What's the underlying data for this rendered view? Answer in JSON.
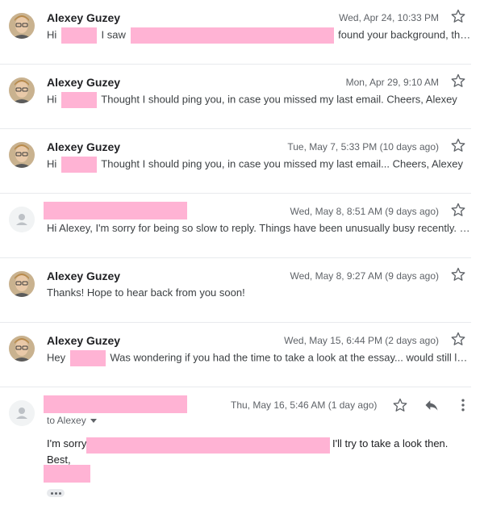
{
  "messages": [
    {
      "sender": "Alexey Guzey",
      "date": "Wed, Apr 24, 10:33 PM",
      "snippet_pre": "Hi",
      "snippet_mid": "I saw",
      "snippet_post": "found your background, tho..."
    },
    {
      "sender": "Alexey Guzey",
      "date": "Mon, Apr 29, 9:10 AM",
      "snippet_pre": "Hi",
      "snippet_post": "Thought I should ping you, in case you missed my last email. Cheers, Alexey"
    },
    {
      "sender": "Alexey Guzey",
      "date": "Tue, May 7, 5:33 PM (10 days ago)",
      "snippet_pre": "Hi",
      "snippet_post": "Thought I should ping you, in case you missed my last email... Cheers, Alexey"
    },
    {
      "date": "Wed, May 8, 8:51 AM (9 days ago)",
      "snippet": "Hi Alexey, I'm sorry for being so slow to reply. Things have been unusually busy recently. I..."
    },
    {
      "sender": "Alexey Guzey",
      "date": "Wed, May 8, 9:27 AM (9 days ago)",
      "snippet": "Thanks! Hope to hear back from you soon!"
    },
    {
      "sender": "Alexey Guzey",
      "date": "Wed, May 15, 6:44 PM (2 days ago)",
      "snippet_pre": "Hey",
      "snippet_post": "Was wondering if you had the time to take a look at the essay... would still lov..."
    }
  ],
  "expanded": {
    "date": "Thu, May 16, 5:46 AM (1 day ago)",
    "to_line": "to Alexey",
    "body_pre": "I'm sorry,",
    "body_post": "I'll try to take a look then.",
    "closing": "Best,"
  },
  "icons": {
    "star": "star-outline-icon",
    "reply": "reply-icon",
    "more": "more-vert-icon",
    "avatar_default": "person-icon"
  },
  "colors": {
    "redaction": "#ffb3d4",
    "divider": "#e8eaed",
    "meta_text": "#5f6368"
  }
}
